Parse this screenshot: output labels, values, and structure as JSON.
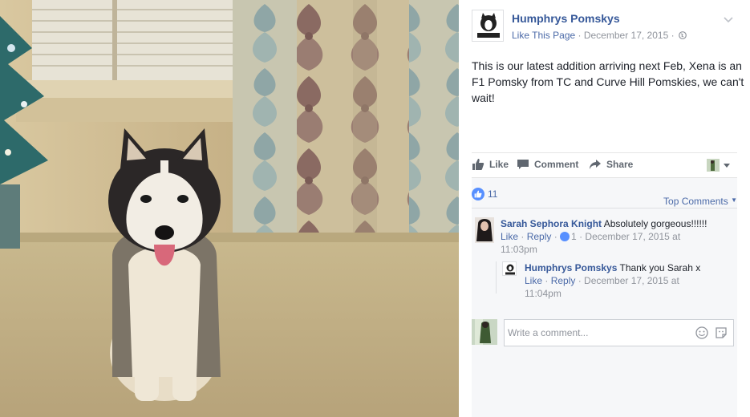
{
  "post": {
    "page_name": "Humphrys Pomskys",
    "like_page": "Like This Page",
    "separator": " · ",
    "date": "December 17, 2015",
    "separator2": " · ",
    "text": "This is our latest addition arriving next Feb, Xena is an F1 Pomsky from TC and Curve Hill Pomskies, we can't wait!"
  },
  "actions": {
    "like": "Like",
    "comment": "Comment",
    "share": "Share"
  },
  "reactions": {
    "count": "11",
    "top_comments": "Top Comments"
  },
  "comments": [
    {
      "author": "Sarah Sephora Knight",
      "text": " Absolutely gorgeous!!!!!!",
      "like": "Like",
      "dot1": " · ",
      "reply": "Reply",
      "dot2": " · ",
      "likes": "1",
      "dot3": " · ",
      "time": "December 17, 2015 at 11:03pm"
    }
  ],
  "reply": {
    "author": "Humphrys Pomskys",
    "text": " Thank you Sarah x",
    "like": "Like",
    "dot1": " · ",
    "reply": "Reply",
    "dot2": " · ",
    "time": "December 17, 2015 at 11:04pm"
  },
  "composer": {
    "placeholder": "Write a comment..."
  },
  "colors": {
    "link": "#365899",
    "meta": "#90949c",
    "like_blue": "#5890ff"
  }
}
